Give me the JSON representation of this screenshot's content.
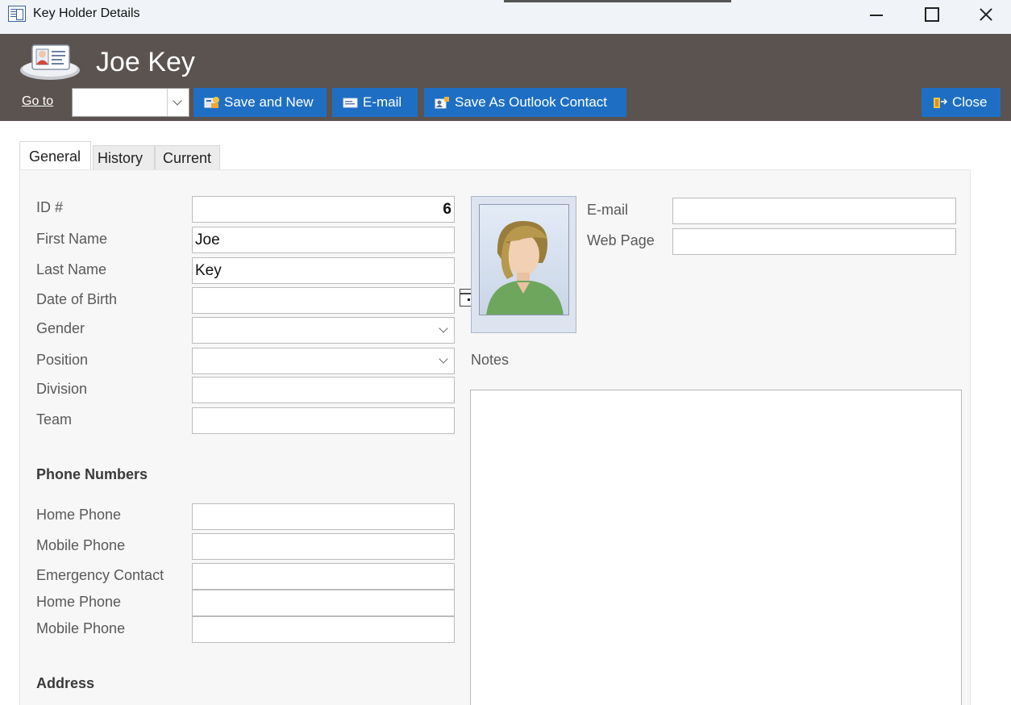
{
  "window": {
    "title": "Key Holder Details"
  },
  "header": {
    "title": "Joe Key",
    "goto_label": "Go to",
    "goto_value": "",
    "buttons": {
      "save_new": "Save and New",
      "email": "E-mail",
      "outlook": "Save As Outlook Contact",
      "close": "Close"
    }
  },
  "tabs": [
    "General",
    "History",
    "Current"
  ],
  "active_tab": "General",
  "form": {
    "id_label": "ID #",
    "id_value": "6",
    "first_name_label": "First Name",
    "first_name_value": "Joe",
    "last_name_label": "Last Name",
    "last_name_value": "Key",
    "dob_label": "Date of Birth",
    "dob_value": "",
    "gender_label": "Gender",
    "gender_value": "",
    "position_label": "Position",
    "position_value": "",
    "division_label": "Division",
    "division_value": "",
    "team_label": "Team",
    "team_value": "",
    "phone_section": "Phone Numbers",
    "home_phone_label": "Home Phone",
    "home_phone_value": "",
    "mobile_phone_label": "Mobile Phone",
    "mobile_phone_value": "",
    "emergency_label": "Emergency Contact",
    "emergency_value": "",
    "em_home_phone_label": "Home Phone",
    "em_home_phone_value": "",
    "em_mobile_phone_label": "Mobile Phone",
    "em_mobile_phone_value": "",
    "address_section": "Address",
    "email_label": "E-mail",
    "email_value": "",
    "webpage_label": "Web Page",
    "webpage_value": "",
    "notes_label": "Notes",
    "notes_value": ""
  },
  "colors": {
    "header_bg": "#5b5350",
    "button_bg": "#1e6fc4",
    "titlebar_bg": "#f0f4f9",
    "page_bg": "#f7f7f7"
  }
}
